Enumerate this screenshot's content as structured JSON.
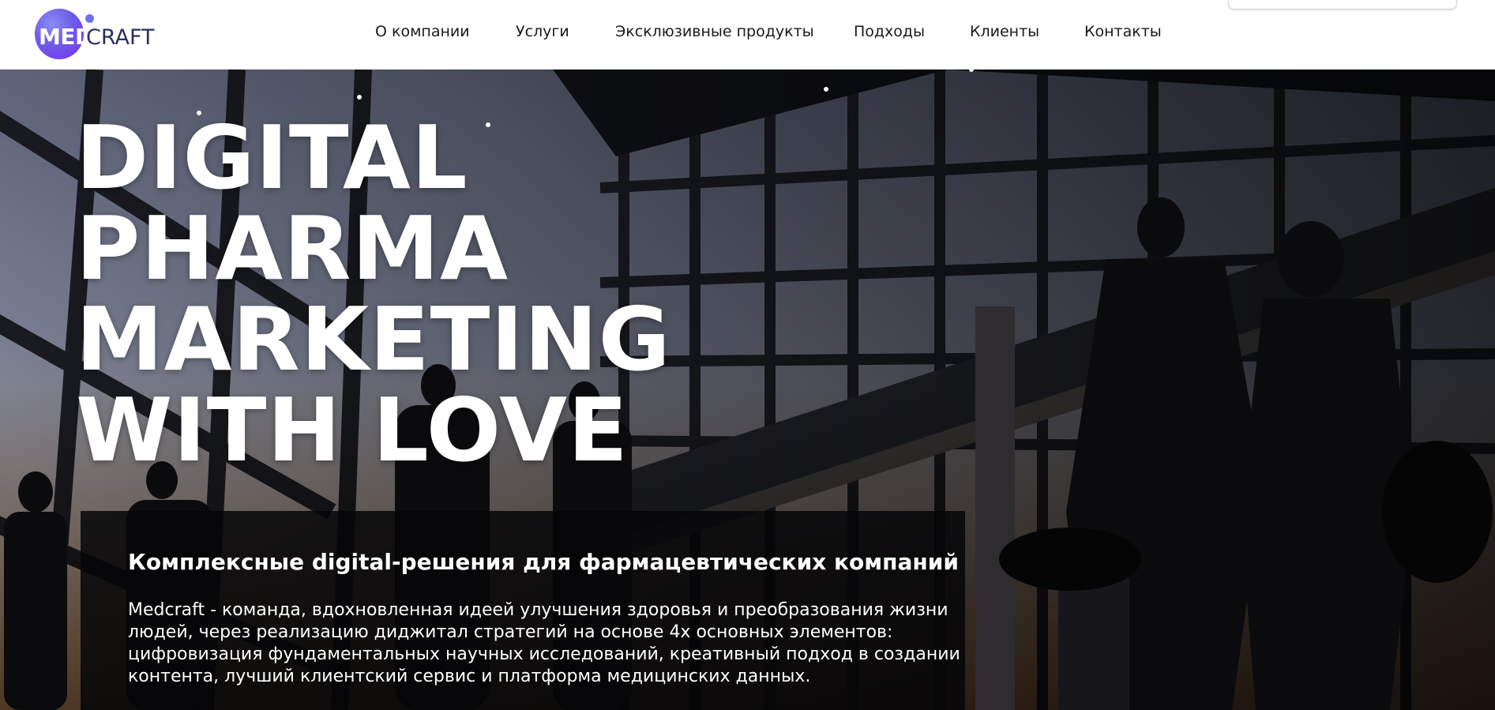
{
  "brand": {
    "logo_text_med": "MED",
    "logo_text_craft": "CRAFT",
    "accent_color": "#6c5ce7",
    "accent_color_dark": "#7b2ff7"
  },
  "nav": {
    "items": [
      {
        "label": "О компании"
      },
      {
        "label": "Услуги"
      },
      {
        "label": "Эксклюзивные продукты"
      },
      {
        "label": "Подходы"
      },
      {
        "label": "Клиенты"
      },
      {
        "label": "Контакты"
      }
    ]
  },
  "hero": {
    "headline_lines": [
      "DIGITAL",
      "PHARMA",
      "MARKETING",
      "WITH LOVE"
    ],
    "info_title": "Комплексные digital-решения для фармацевтических компаний",
    "info_text": "Medcraft - команда, вдохновленная идеей улучшения здоровья и преобразования жизни людей, через реализацию диджитал стратегий на основе 4х основных элементов: цифровизация фундаментальных научных исследований, креативный подход в создании контента, лучший клиентский сервис и платформа медицинских данных."
  }
}
